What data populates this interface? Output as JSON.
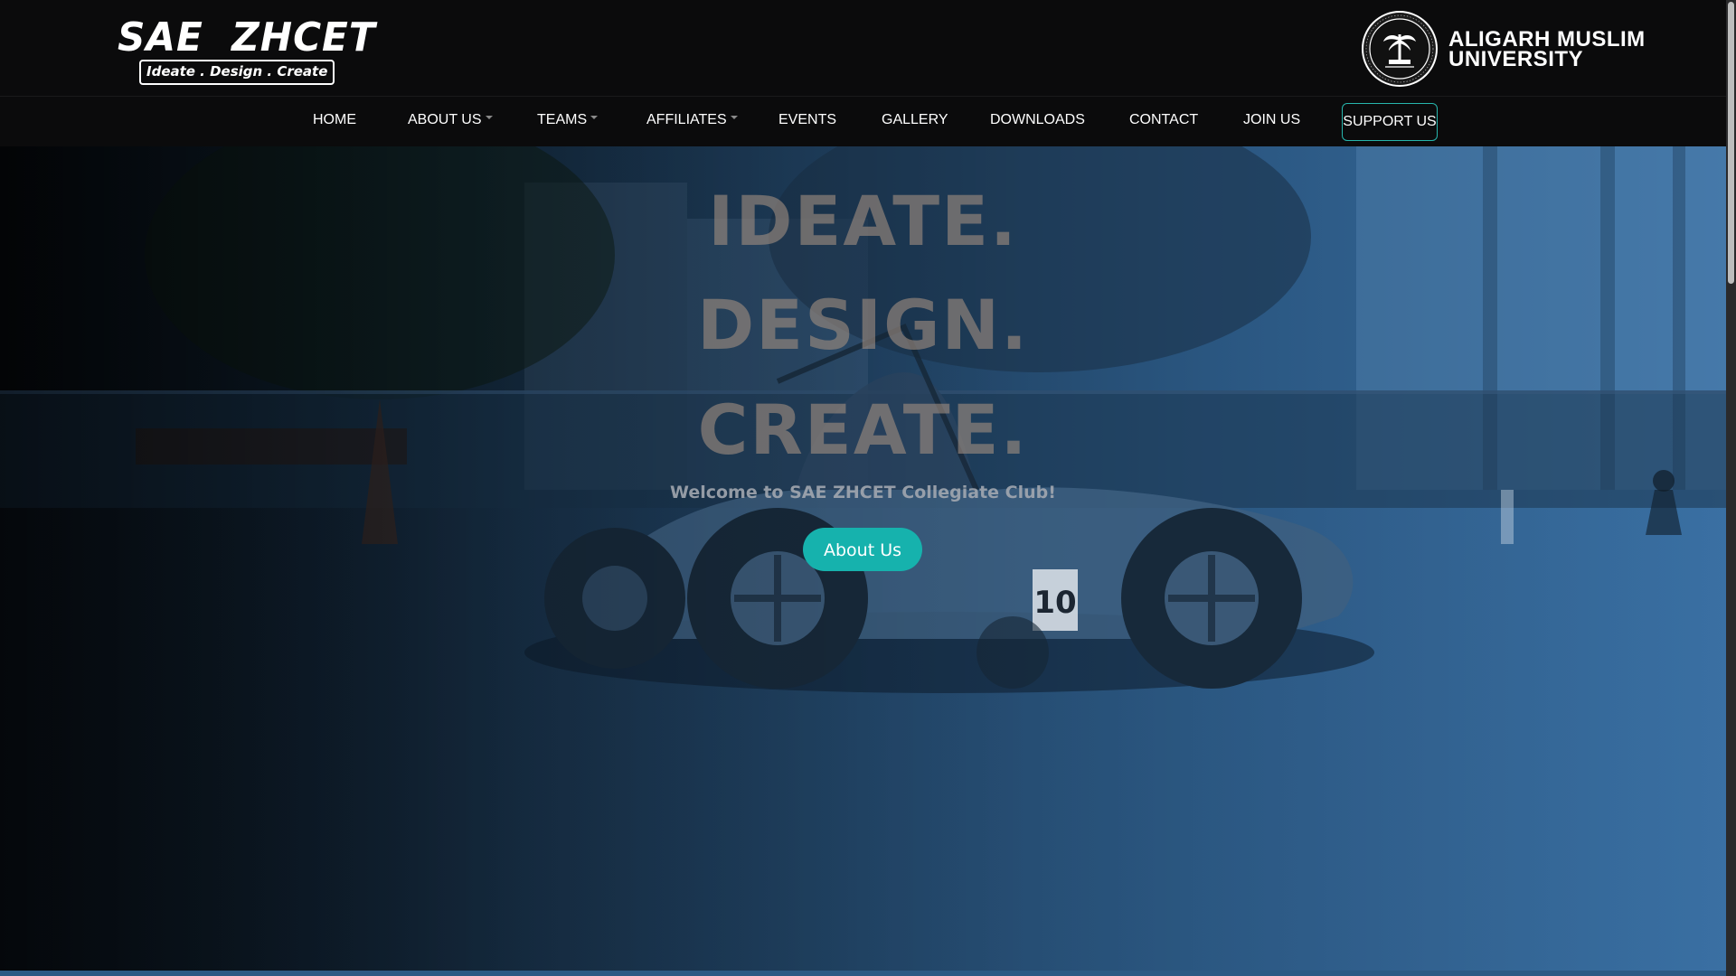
{
  "header": {
    "brand_title": "SAE  ZHCET",
    "brand_tagline": "Ideate . Design . Create",
    "university_line1": "ALIGARH MUSLIM",
    "university_line2": "UNIVERSITY"
  },
  "nav": {
    "items": [
      {
        "label": "HOME",
        "dropdown": false
      },
      {
        "label": "ABOUT US",
        "dropdown": true
      },
      {
        "label": "TEAMS",
        "dropdown": true
      },
      {
        "label": "AFFILIATES",
        "dropdown": true
      },
      {
        "label": "EVENTS",
        "dropdown": false
      },
      {
        "label": "GALLERY",
        "dropdown": false
      },
      {
        "label": "DOWNLOADS",
        "dropdown": false
      },
      {
        "label": "CONTACT",
        "dropdown": false
      },
      {
        "label": "JOIN US",
        "dropdown": false
      }
    ],
    "support_label": "SUPPORT US",
    "support_border_color": "#27b6ad"
  },
  "hero": {
    "slogan_line1": "IDEATE.",
    "slogan_line2": "DESIGN.",
    "slogan_line3": "CREATE.",
    "welcome": "Welcome to SAE ZHCET Collegiate Club!",
    "cta_label": "About Us",
    "cta_color": "#16b2ad",
    "car_number": "10"
  },
  "icons": {
    "university_logo": "amu-seal-icon",
    "caret": "caret-down-icon"
  }
}
